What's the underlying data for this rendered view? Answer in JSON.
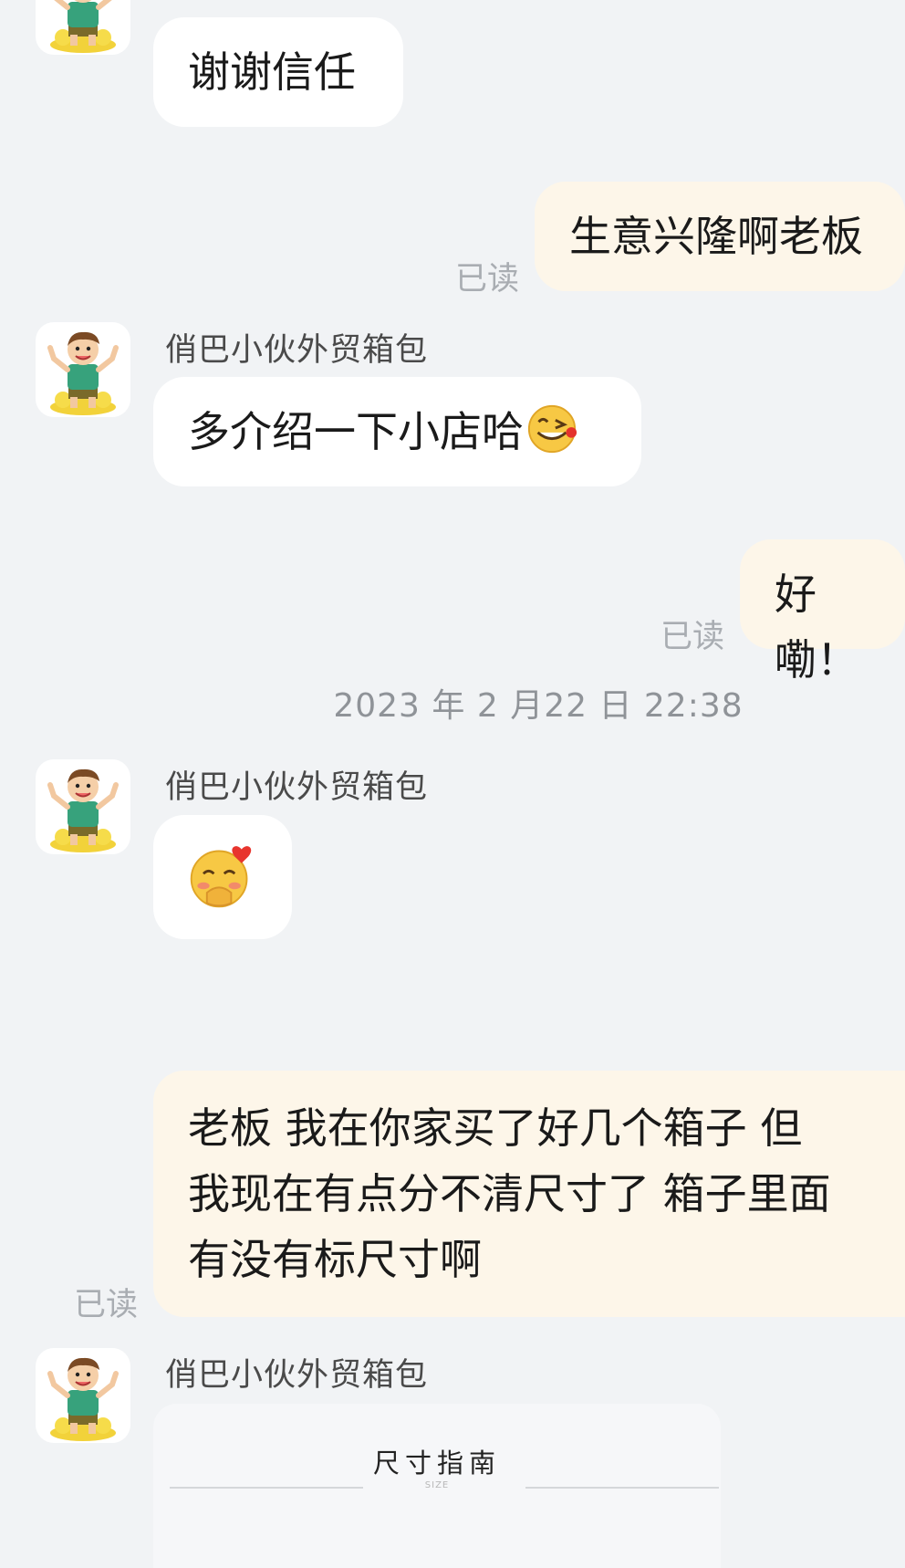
{
  "contact_name": "俏巴小伙外贸箱包",
  "messages": {
    "m1": "谢谢信任",
    "m2": "生意兴隆啊老板",
    "m3": "多介绍一下小店哈",
    "m4": "好嘞！",
    "m6_line1": "老板 我在你家买了好几个箱子 但",
    "m6_line2": "我现在有点分不清尺寸了 箱子里面",
    "m6_line3": "有没有标尺寸啊"
  },
  "read_label": "已读",
  "timestamp": "2023 年 2 月22 日 22:38",
  "size_card": {
    "title": "尺寸指南",
    "subtitle": "SIZE"
  },
  "colors": {
    "background": "#f1f3f5",
    "incoming_bubble": "#ffffff",
    "outgoing_bubble": "#fdf6e9",
    "read_text": "#a9adb2"
  },
  "icons": {
    "tongue_emoji": "face-with-tongue-icon",
    "blush_emoji": "blushing-face-with-heart-icon",
    "avatar": "cartoon-boy-avatar"
  }
}
